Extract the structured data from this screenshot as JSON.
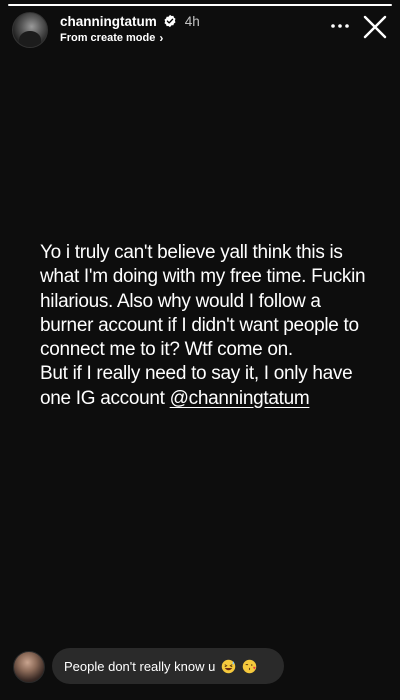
{
  "story": {
    "progress_fraction": 1.0,
    "background": "#0d0d0d"
  },
  "header": {
    "username": "channingtatum",
    "verified": true,
    "time_ago": "4h",
    "subtitle": "From create mode",
    "subtitle_chevron": "›",
    "more_icon": "more-horizontal-icon",
    "close_icon": "close-icon"
  },
  "message": {
    "line1": "Yo i truly can't believe yall think this is",
    "line2": "what I'm doing with my free time. Fuckin",
    "line3": "hilarious. Also why would I follow a",
    "line4": "burner account if I didn't want people to",
    "line5": "connect me to it? Wtf come on.",
    "line6": "But if I really need to say it, I only have",
    "line7_prefix": "one IG account ",
    "mention": "@channingtatum"
  },
  "reply": {
    "text": "People don't really know u",
    "emojis": [
      "laughing-sweat-emoji",
      "kissing-heart-emoji"
    ]
  },
  "colors": {
    "verified_badge": "#3897f0",
    "reply_bubble": "#2a2a2a"
  }
}
